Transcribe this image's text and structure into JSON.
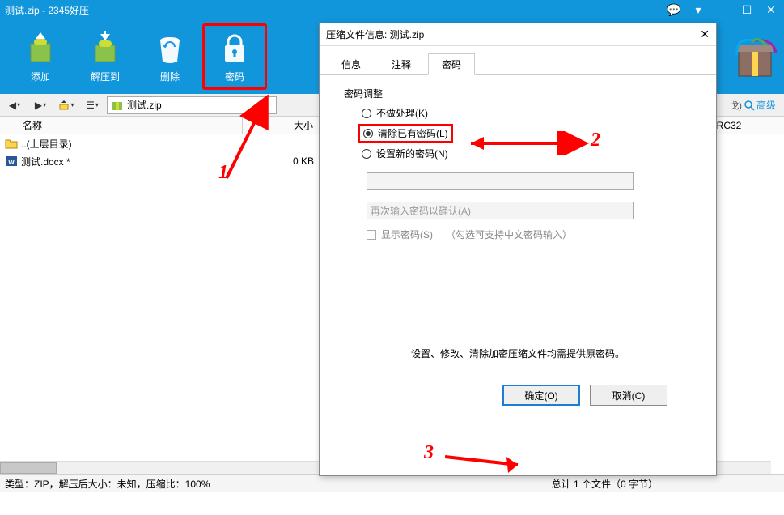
{
  "titlebar": {
    "title": "测试.zip - 2345好压"
  },
  "toolbar": {
    "add": "添加",
    "extract": "解压到",
    "delete": "删除",
    "password": "密码"
  },
  "navbar": {
    "path": "测试.zip",
    "advanced": "高级"
  },
  "columns": {
    "name": "名称",
    "size": "大小",
    "crc": "CRC32"
  },
  "files": {
    "updir": "..(上层目录)",
    "row1": {
      "name": "测试.docx *",
      "size": "0 KB"
    }
  },
  "statusbar": {
    "left": "类型：ZIP，解压后大小：未知，压缩比：100%",
    "right": "总计 1 个文件（0 字节）"
  },
  "dialog": {
    "title": "压缩文件信息: 测试.zip",
    "tabs": {
      "info": "信息",
      "comment": "注释",
      "password": "密码"
    },
    "fieldset": "密码调整",
    "radio_none": "不做处理(K)",
    "radio_clear": "清除已有密码(L)",
    "radio_set": "设置新的密码(N)",
    "ph_confirm": "再次输入密码以确认(A)",
    "chk_show": "显示密码(S)",
    "chk_hint": "（勾选可支持中文密码输入）",
    "note": "设置、修改、清除加密压缩文件均需提供原密码。",
    "ok": "确定(O)",
    "cancel": "取消(C)"
  },
  "annotations": {
    "n1": "1",
    "n2": "2",
    "n3": "3"
  },
  "right_text": {
    "cancel_short": "戈)"
  }
}
